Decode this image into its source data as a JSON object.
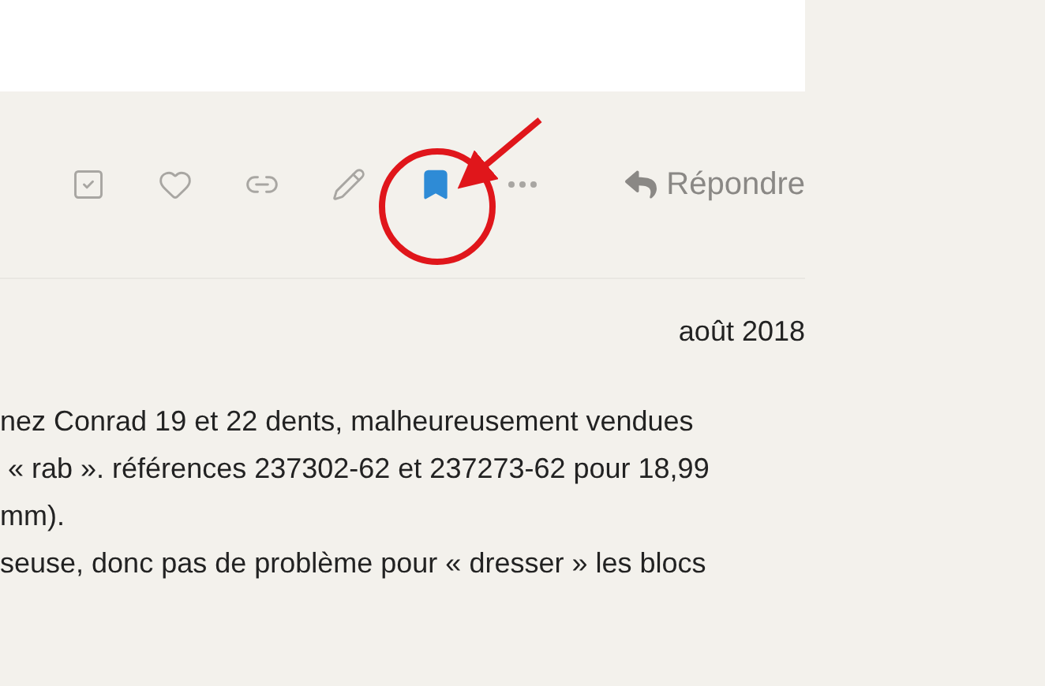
{
  "post_actions": [
    {
      "kind": "solved",
      "active": false
    },
    {
      "kind": "like",
      "active": false
    },
    {
      "kind": "link",
      "active": false
    },
    {
      "kind": "edit",
      "active": false
    },
    {
      "kind": "bookmark",
      "active": true
    },
    {
      "kind": "more",
      "active": false
    }
  ],
  "reply_button": {
    "label": "Répondre"
  },
  "annotation": {
    "kind": "circle-arrow",
    "color": "#e0161b"
  },
  "post": {
    "date": "août 2018",
    "lines": [
      "nez Conrad 19 et 22 dents, malheureusement vendues",
      " « rab ». références 237302-62 et 237273-62 pour 18,99",
      "mm).",
      "seuse, donc pas de problème pour « dresser » les blocs"
    ]
  }
}
